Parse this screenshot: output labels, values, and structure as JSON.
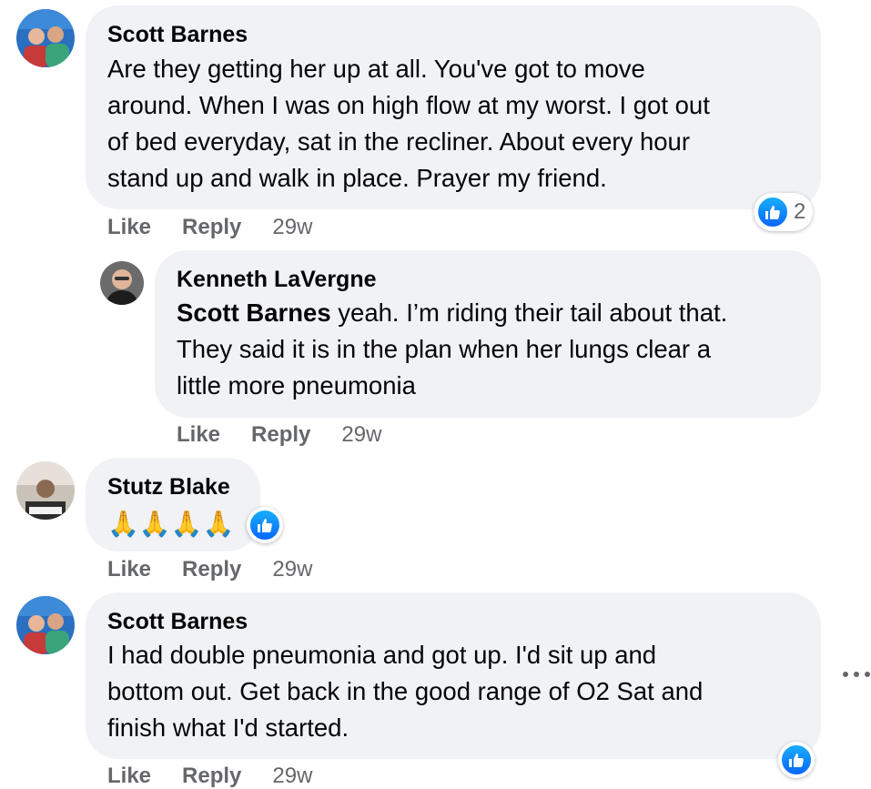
{
  "comments": [
    {
      "author": "Scott Barnes",
      "lines": [
        "Are they getting her up at all. You've got to move",
        "around. When I was on high flow at my worst. I got out",
        "of bed everyday, sat in the recliner. About every hour",
        "stand up and walk in place. Prayer my friend."
      ],
      "reaction_icon": "like-icon",
      "reaction_count": "2",
      "actions": {
        "like": "Like",
        "reply": "Reply",
        "time": "29w"
      }
    },
    {
      "author": "Kenneth LaVergne",
      "mention": "Scott Barnes",
      "lines": [
        " yeah. I’m riding their tail about that.",
        "They said it is in the plan when her lungs clear a",
        "little more pneumonia"
      ],
      "actions": {
        "like": "Like",
        "reply": "Reply",
        "time": "29w"
      }
    },
    {
      "author": "Stutz Blake",
      "emoji": "🙏🙏🙏🙏",
      "reaction_icon": "like-icon",
      "actions": {
        "like": "Like",
        "reply": "Reply",
        "time": "29w"
      }
    },
    {
      "author": "Scott Barnes",
      "lines": [
        "I had double pneumonia and got up. I'd sit up and",
        "bottom out. Get back in the good range of O2 Sat and",
        "finish what I'd started."
      ],
      "reaction_icon": "like-icon",
      "actions": {
        "like": "Like",
        "reply": "Reply",
        "time": "29w"
      }
    }
  ],
  "colors": {
    "bubble": "#f0f2f5",
    "secondary_text": "#65676b",
    "like_blue": "#0866ff"
  },
  "more_icon": "more-options-icon"
}
